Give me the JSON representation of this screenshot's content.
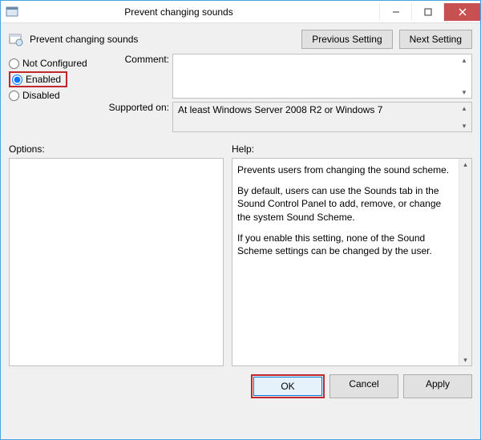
{
  "titlebar": {
    "title": "Prevent changing sounds"
  },
  "header": {
    "title": "Prevent changing sounds",
    "prev_label": "Previous Setting",
    "next_label": "Next Setting"
  },
  "radios": {
    "not_configured": "Not Configured",
    "enabled": "Enabled",
    "disabled": "Disabled",
    "selected": "enabled"
  },
  "labels": {
    "comment": "Comment:",
    "supported": "Supported on:",
    "options": "Options:",
    "help": "Help:"
  },
  "fields": {
    "comment_value": "",
    "supported_value": "At least Windows Server 2008 R2 or Windows 7"
  },
  "help": {
    "p1": "Prevents users from changing the sound scheme.",
    "p2": "By default, users can use the Sounds tab in the Sound Control Panel to add, remove, or change the system Sound Scheme.",
    "p3": "If you enable this setting, none of the Sound Scheme settings can be changed by the user."
  },
  "footer": {
    "ok": "OK",
    "cancel": "Cancel",
    "apply": "Apply"
  }
}
